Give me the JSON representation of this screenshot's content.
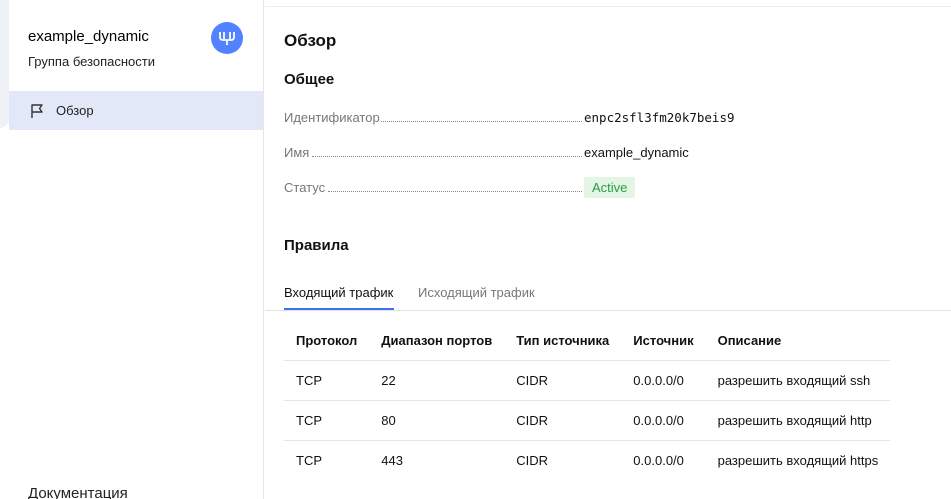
{
  "sidebar": {
    "resource_title": "example_dynamic",
    "resource_subtitle": "Группа безопасности",
    "service_icon": "vpc-service-icon",
    "service_icon_color": "#5282ff",
    "nav": [
      {
        "label": "Обзор",
        "icon": "flag-icon",
        "active": true
      }
    ],
    "docs_label": "Документация"
  },
  "main": {
    "page_title": "Обзор",
    "general": {
      "title": "Общее",
      "id_label": "Идентификатор",
      "id_value": "enpc2sfl3fm20k7beis9",
      "name_label": "Имя",
      "name_value": "example_dynamic",
      "status_label": "Статус",
      "status_value": "Active",
      "status_color": "#2b9a42"
    },
    "rules": {
      "title": "Правила",
      "tabs": [
        {
          "label": "Входящий трафик",
          "active": true
        },
        {
          "label": "Исходящий трафик",
          "active": false
        }
      ],
      "columns": [
        "Протокол",
        "Диапазон портов",
        "Тип источника",
        "Источник",
        "Описание"
      ],
      "rows": [
        [
          "TCP",
          "22",
          "CIDR",
          "0.0.0.0/0",
          "разрешить входящий ssh"
        ],
        [
          "TCP",
          "80",
          "CIDR",
          "0.0.0.0/0",
          "разрешить входящий http"
        ],
        [
          "TCP",
          "443",
          "CIDR",
          "0.0.0.0/0",
          "разрешить входящий https"
        ]
      ]
    }
  },
  "colors": {
    "accent": "#3d73e8",
    "nav_active_bg": "#e2e8f7"
  }
}
